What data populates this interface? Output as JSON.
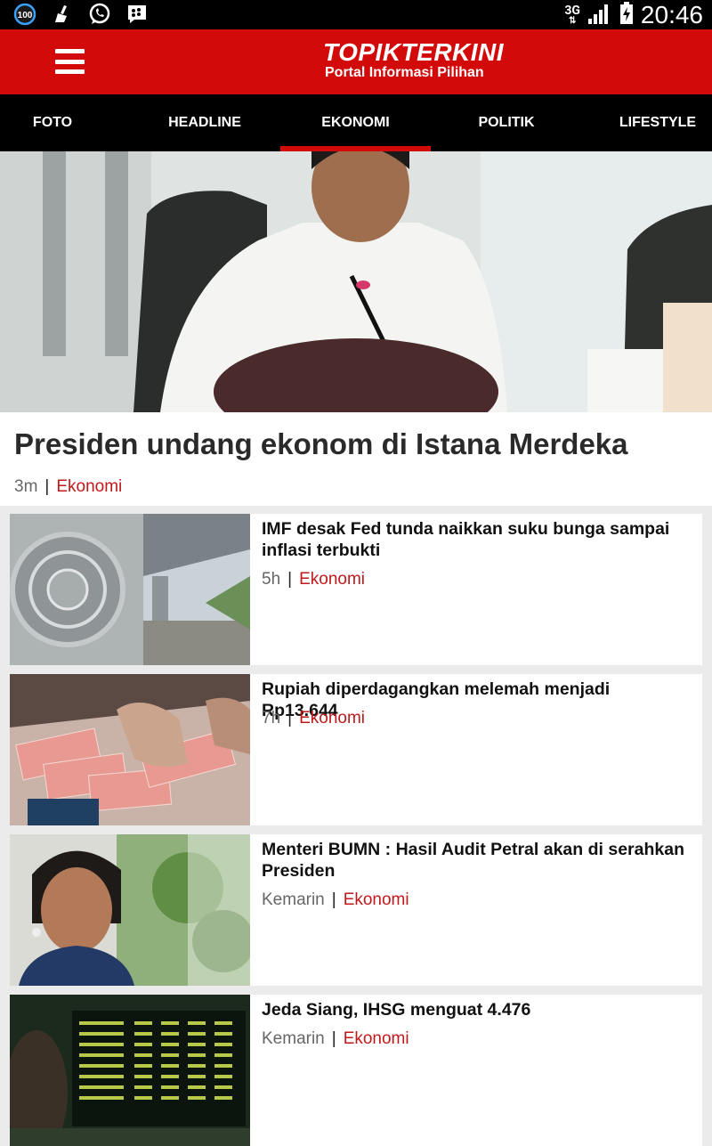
{
  "status_bar": {
    "badge": "100",
    "network": "3G",
    "time": "20:46",
    "icons": [
      "notification-100-icon",
      "cleaner-icon",
      "whatsapp-icon",
      "bbm-icon",
      "signal-icon",
      "battery-charging-icon"
    ]
  },
  "header": {
    "logo_main": "TOPIKTERKINI",
    "logo_sub": "Portal Informasi Pilihan",
    "brand_color": "#d20a0a"
  },
  "tabs": [
    {
      "label": "FOTO"
    },
    {
      "label": "HEADLINE"
    },
    {
      "label": "EKONOMI",
      "active": true
    },
    {
      "label": "POLITIK"
    },
    {
      "label": "LIFESTYLE"
    }
  ],
  "hero": {
    "title": "Presiden undang ekonom di Istana Merdeka",
    "time": "3m",
    "separator": "|",
    "category": "Ekonomi"
  },
  "articles": [
    {
      "title": "IMF desak Fed tunda naikkan suku bunga sampai inflasi terbukti",
      "time": "5h",
      "separator": "|",
      "category": "Ekonomi"
    },
    {
      "title": "Rupiah diperdagangkan melemah menjadi Rp13.644",
      "time": "7h",
      "separator": "|",
      "category": "Ekonomi"
    },
    {
      "title": "Menteri BUMN : Hasil Audit Petral akan di serahkan Presiden",
      "time": "Kemarin",
      "separator": "|",
      "category": "Ekonomi"
    },
    {
      "title": "Jeda Siang, IHSG menguat 4.476",
      "time": "Kemarin",
      "separator": "|",
      "category": "Ekonomi"
    }
  ]
}
